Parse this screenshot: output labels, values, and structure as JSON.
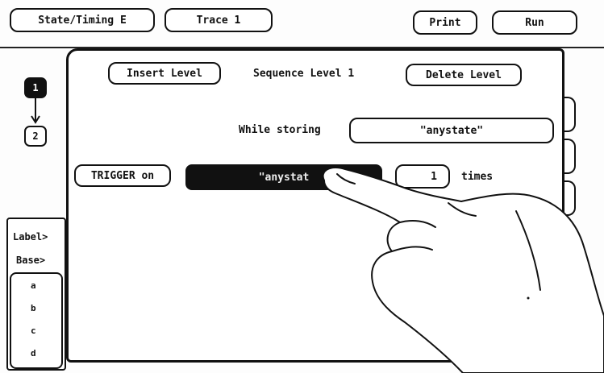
{
  "header": {
    "state_timing_label": "State/Timing E",
    "trace_label": "Trace 1",
    "print_label": "Print",
    "run_label": "Run"
  },
  "sequence": {
    "insert_level_label": "Insert Level",
    "title": "Sequence Level 1",
    "delete_level_label": "Delete Level",
    "levels": [
      "1",
      "2"
    ],
    "while_storing_label": "While storing",
    "while_storing_value": "\"anystate\"",
    "trigger_on_label": "TRIGGER on",
    "trigger_value": "\"anystat",
    "trigger_count": "1",
    "times_label": "times"
  },
  "sidebar": {
    "label_label": "Label>",
    "base_label": "Base>",
    "items": [
      "a",
      "b",
      "c",
      "d"
    ]
  }
}
